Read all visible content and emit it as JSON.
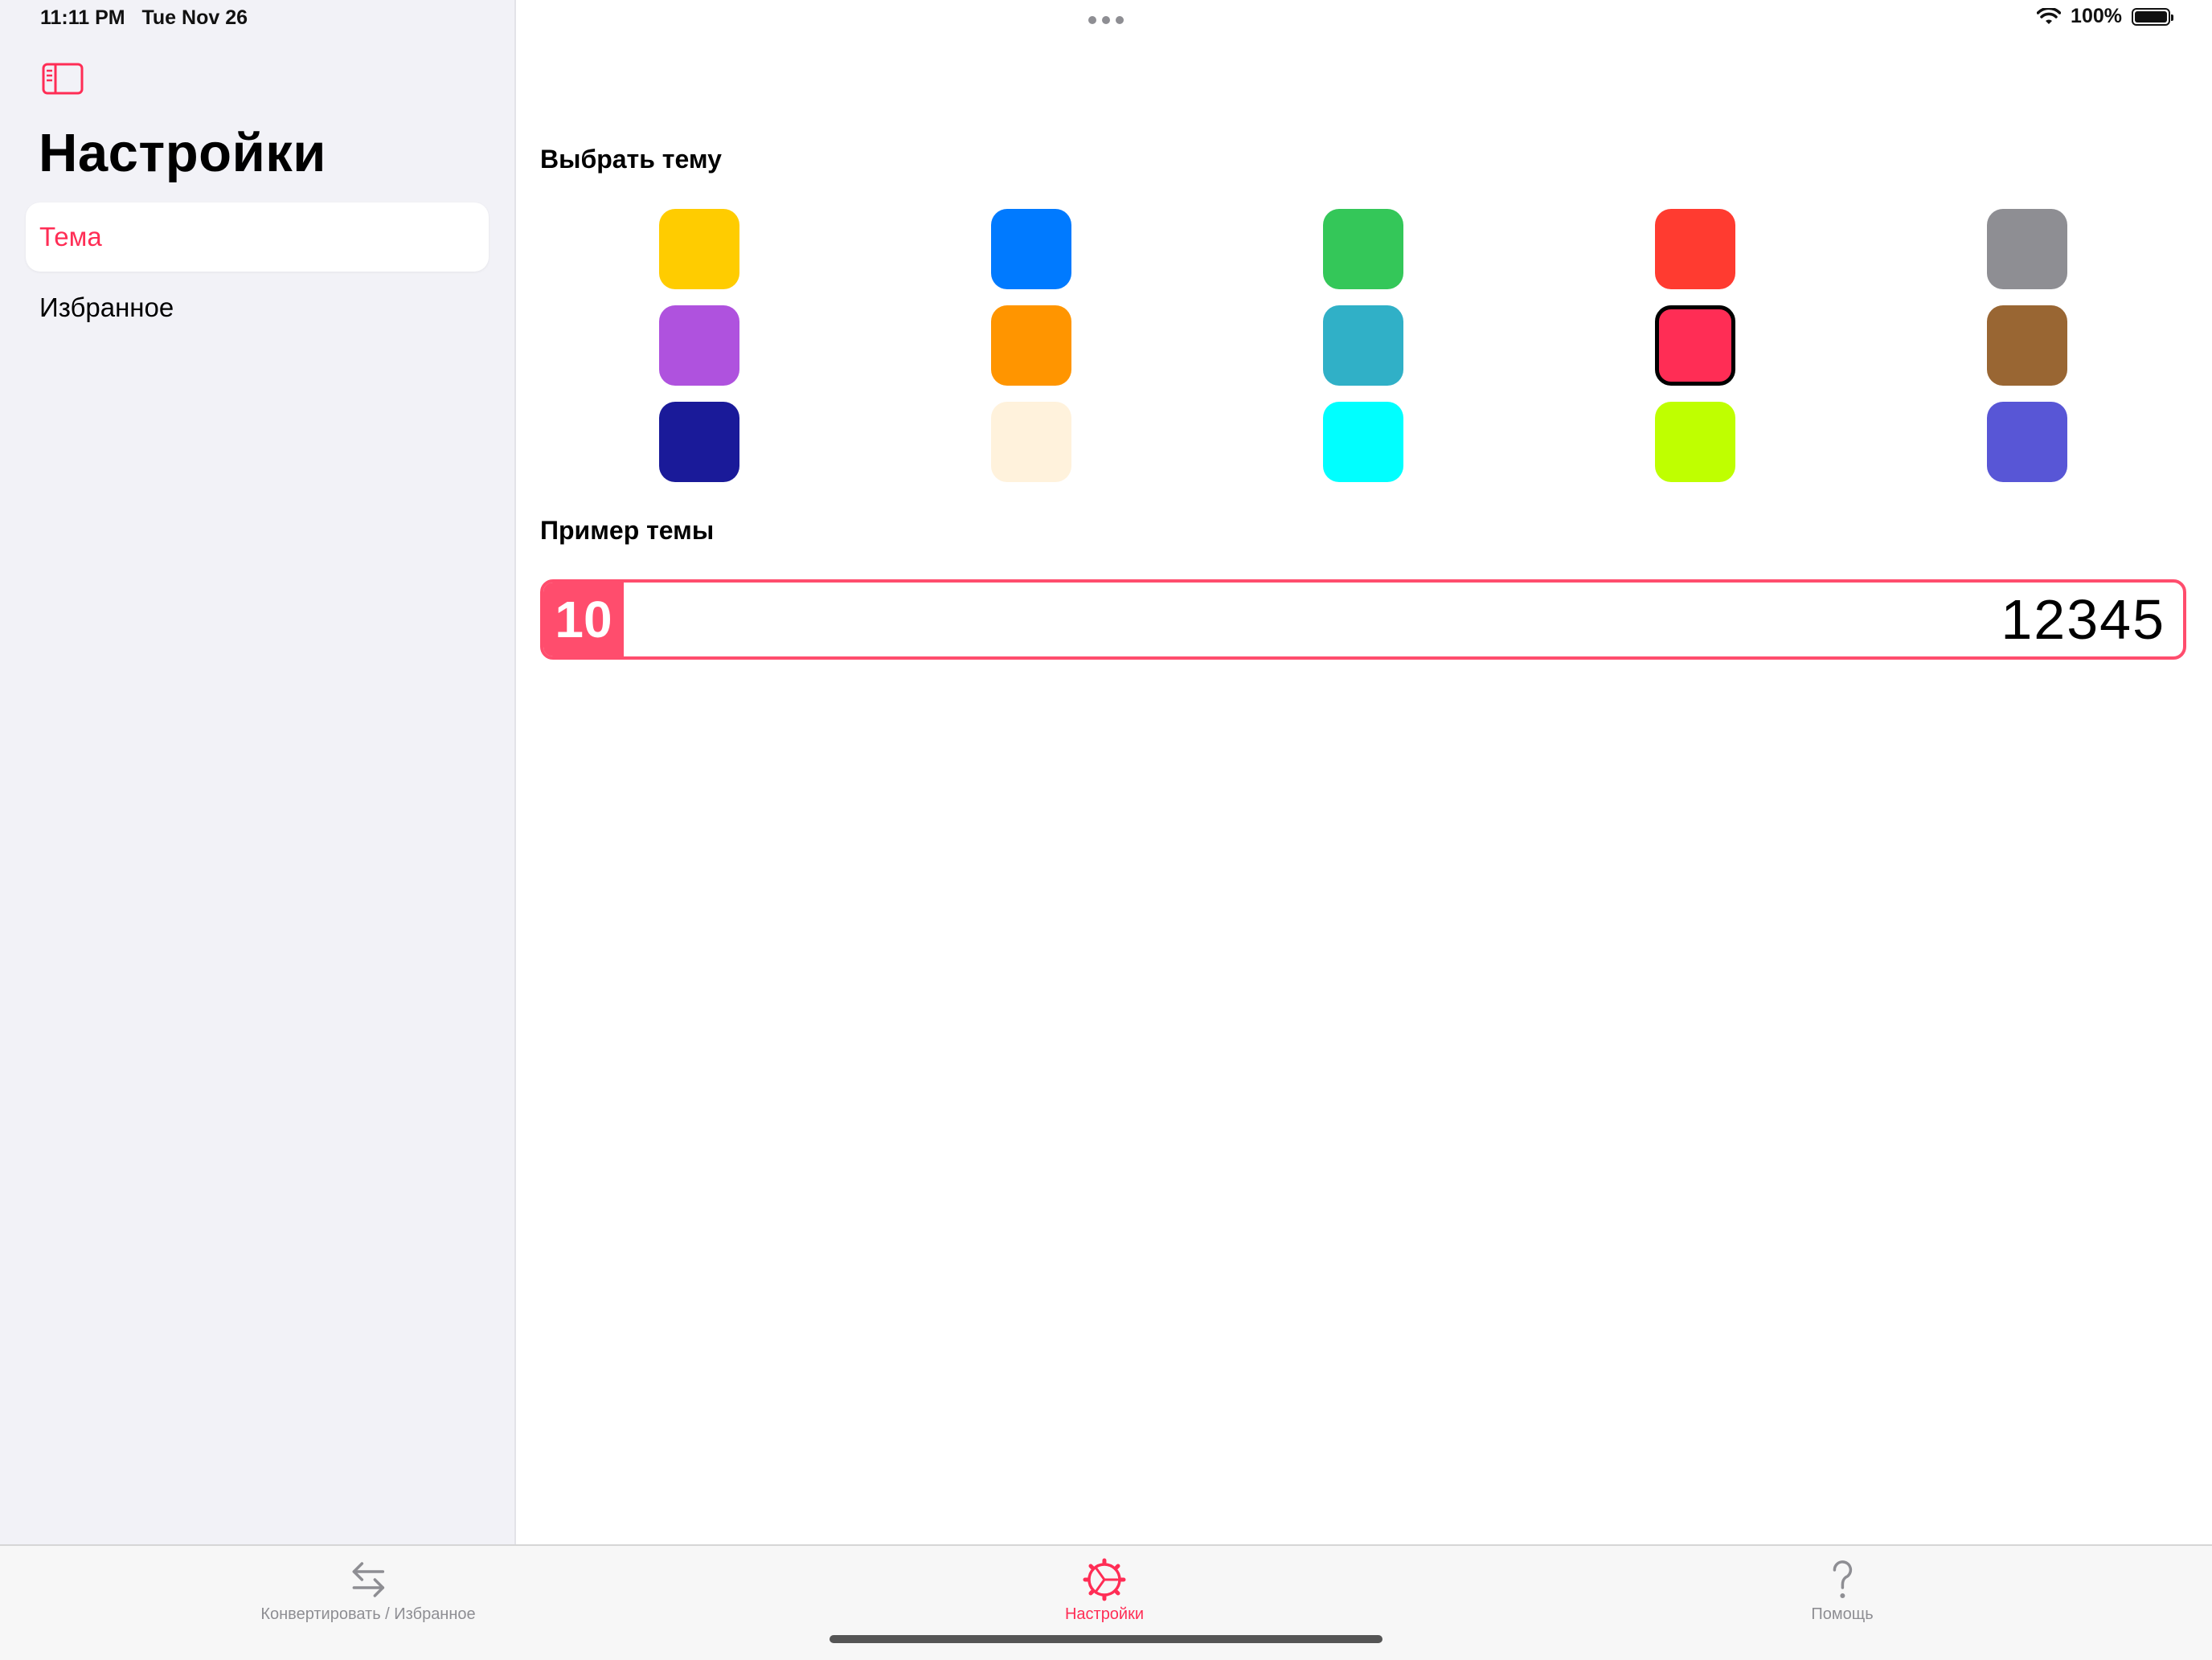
{
  "status": {
    "time": "11:11 PM",
    "date": "Tue Nov 26",
    "battery": "100%"
  },
  "sidebar": {
    "title": "Настройки",
    "items": [
      {
        "label": "Тема",
        "selected": true
      },
      {
        "label": "Избранное",
        "selected": false
      }
    ]
  },
  "main": {
    "choose_theme_title": "Выбрать тему",
    "preview_title": "Пример темы",
    "swatches": [
      {
        "color": "#ffcc00"
      },
      {
        "color": "#007aff"
      },
      {
        "color": "#34c759"
      },
      {
        "color": "#ff3b30"
      },
      {
        "color": "#8e8e93"
      },
      {
        "color": "#af52de"
      },
      {
        "color": "#ff9500"
      },
      {
        "color": "#30b0c7"
      },
      {
        "color": "#ff2d55",
        "selected": true
      },
      {
        "color": "#996633"
      },
      {
        "color": "#1a1a99"
      },
      {
        "color": "#fff2dc"
      },
      {
        "color": "#00ffff"
      },
      {
        "color": "#bfff00"
      },
      {
        "color": "#5856d6"
      }
    ],
    "preview": {
      "badge": "10",
      "value": "12345",
      "accent": "#ff4d6d"
    }
  },
  "tabbar": {
    "tabs": [
      {
        "label": "Конвертировать / Избранное",
        "icon": "arrows-exchange-icon",
        "active": false
      },
      {
        "label": "Настройки",
        "icon": "gear-icon",
        "active": true
      },
      {
        "label": "Помощь",
        "icon": "question-icon",
        "active": false
      }
    ]
  },
  "colors": {
    "accent": "#ff2d55",
    "sidebar_bg": "#f2f2f7"
  }
}
